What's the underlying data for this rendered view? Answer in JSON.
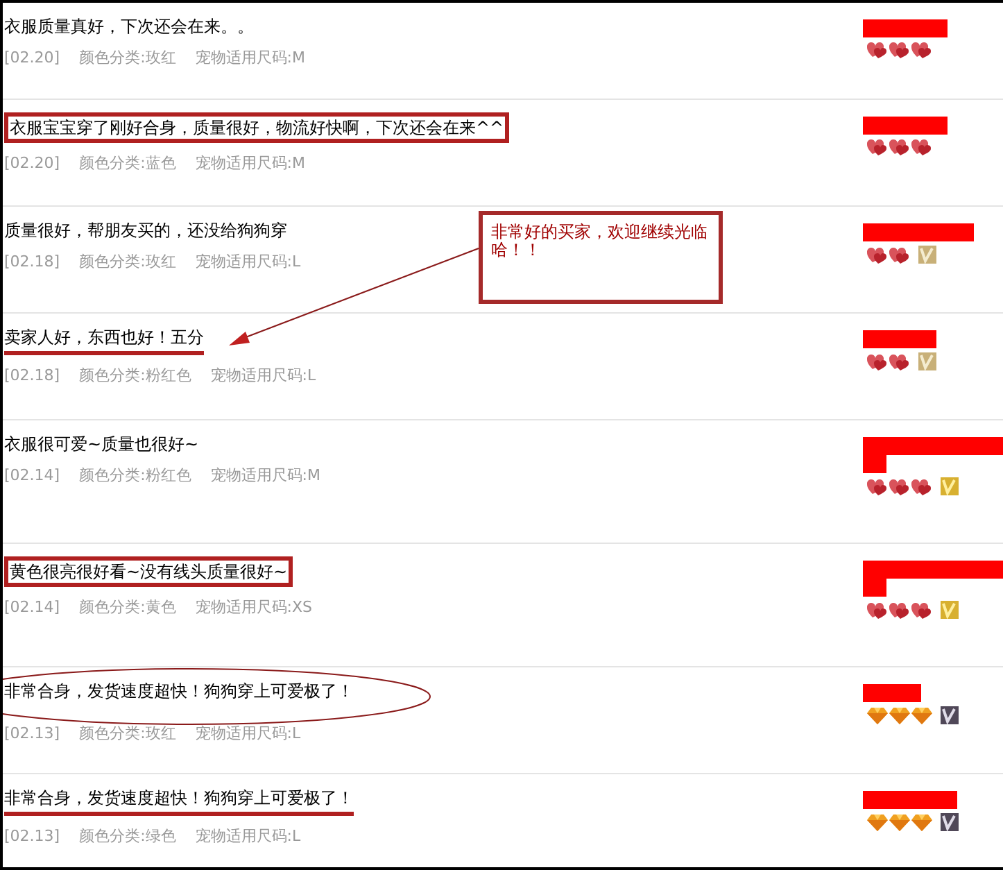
{
  "reviews": [
    {
      "kind": "plain",
      "comment": "衣服质量真好，下次还会在来。。",
      "date": "[02.20]",
      "color_category": "颜色分类:玫红",
      "size": "宠物适用尺码:M",
      "rank": {
        "kind": "threehearts"
      }
    },
    {
      "kind": "boxed",
      "comment": "衣服宝宝穿了刚好合身，质量很好，物流好快啊，下次还会在来^^",
      "date": "[02.20]",
      "color_category": "颜色分类:蓝色",
      "size": "宠物适用尺码:M",
      "rank": {
        "kind": "threehearts"
      }
    },
    {
      "kind": "plain",
      "comment": "质量很好，帮朋友买的，还没给狗狗穿",
      "date": "[02.18]",
      "color_category": "颜色分类:玫红",
      "size": "宠物适用尺码:L",
      "rank": {
        "kind": "twohearts"
      },
      "badge": {
        "kind": "tan"
      }
    },
    {
      "kind": "underlined",
      "comment": "卖家人好，东西也好！五分",
      "date": "[02.18]",
      "color_category": "颜色分类:粉红色",
      "size": "宠物适用尺码:L",
      "rank": {
        "kind": "twohearts"
      },
      "badge": {
        "kind": "tan"
      }
    },
    {
      "kind": "plain",
      "comment": "衣服很可爱~质量也很好~",
      "date": "[02.14]",
      "color_category": "颜色分类:粉红色",
      "size": "宠物适用尺码:M",
      "rank": {
        "kind": "threehearts"
      },
      "badge": {
        "kind": "gold"
      }
    },
    {
      "kind": "boxed",
      "comment": "黄色很亮很好看~没有线头质量很好~",
      "date": "[02.14]",
      "color_category": "颜色分类:黄色",
      "size": "宠物适用尺码:XS",
      "rank": {
        "kind": "threehearts"
      },
      "badge": {
        "kind": "gold"
      }
    },
    {
      "kind": "circled",
      "comment": "非常合身，发货速度超快！狗狗穿上可爱极了！",
      "date": "[02.13]",
      "color_category": "颜色分类:玫红",
      "size": "宠物适用尺码:L",
      "rank": {
        "kind": "threediamonds"
      },
      "badge": {
        "kind": "dark"
      }
    },
    {
      "kind": "underlined",
      "comment": "非常合身，发货速度超快！狗狗穿上可爱极了！",
      "date": "[02.13]",
      "color_category": "颜色分类:绿色",
      "size": "宠物适用尺码:L",
      "rank": {
        "kind": "threediamonds"
      },
      "badge": {
        "kind": "dark"
      }
    }
  ],
  "callout": {
    "text": "非常好的买家，欢迎继续光临哈！！"
  }
}
